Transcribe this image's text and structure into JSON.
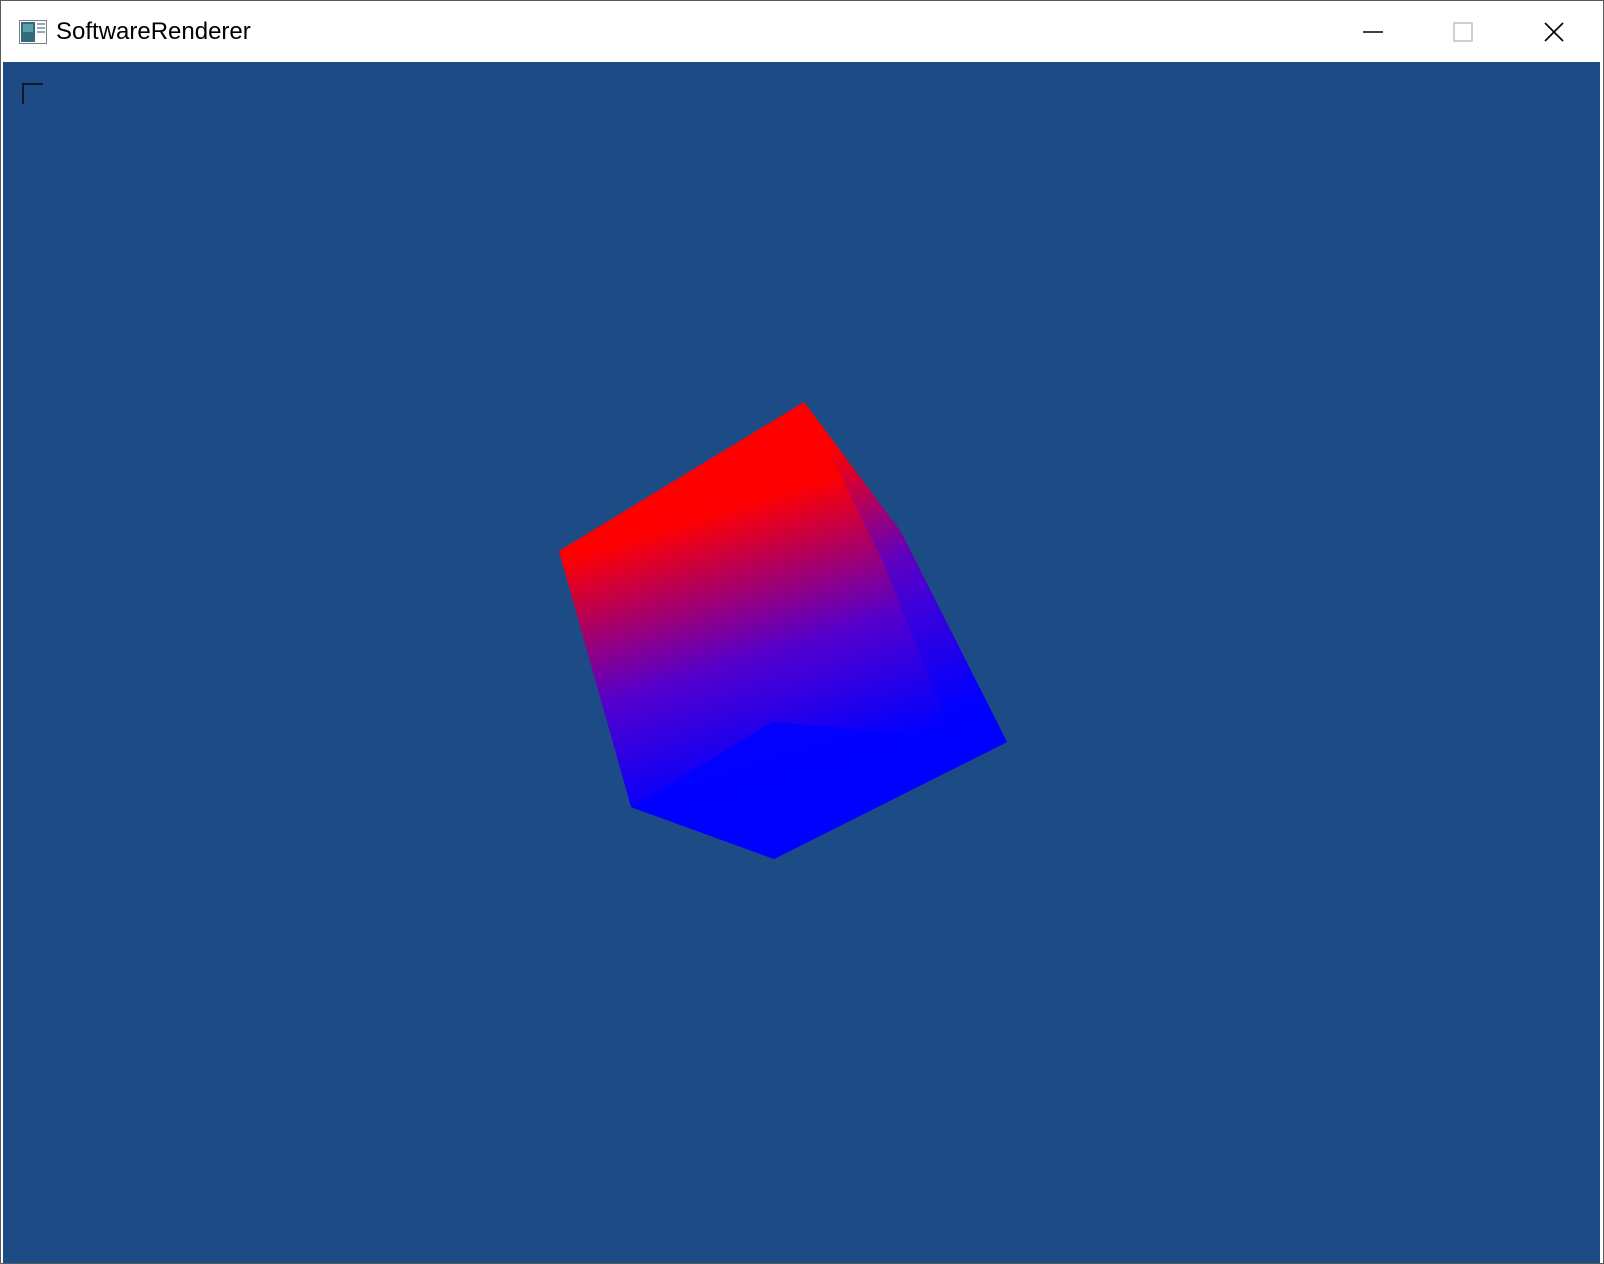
{
  "window": {
    "title": "SoftwareRenderer",
    "app_icon": "app-window-icon",
    "controls": {
      "minimize_icon": "minimize-icon",
      "maximize_icon": "maximize-icon",
      "close_icon": "close-icon"
    }
  },
  "viewport": {
    "background_color": "#1d4b85",
    "corner_marker_icon": "corner-bracket-icon",
    "cube": {
      "top_color": "#ff0000",
      "bottom_color": "#0000ff",
      "mid_color": "#5500cc"
    }
  }
}
